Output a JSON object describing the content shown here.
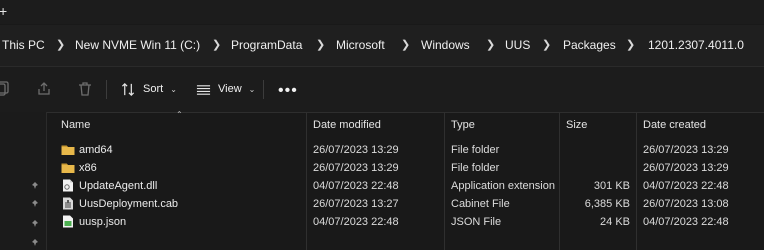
{
  "window": {
    "new_tab_glyph": "+"
  },
  "breadcrumb": [
    "This PC",
    "New NVME Win 11 (C:)",
    "ProgramData",
    "Microsoft",
    "Windows",
    "UUS",
    "Packages",
    "1201.2307.4011.0"
  ],
  "toolbar": {
    "sort_label": "Sort",
    "view_label": "View",
    "more_label": "•••",
    "icons": [
      "copy-icon",
      "share-icon",
      "delete-icon",
      "sort-icon",
      "view-icon",
      "more-icon"
    ]
  },
  "columns": {
    "name": "Name",
    "date_modified": "Date modified",
    "type": "Type",
    "size": "Size",
    "date_created": "Date created"
  },
  "files": [
    {
      "icon": "folder-icon",
      "name": "amd64",
      "date_modified": "26/07/2023 13:29",
      "type": "File folder",
      "size": "",
      "date_created": "26/07/2023 13:29"
    },
    {
      "icon": "folder-icon",
      "name": "x86",
      "date_modified": "26/07/2023 13:29",
      "type": "File folder",
      "size": "",
      "date_created": "26/07/2023 13:29"
    },
    {
      "icon": "dll-file-icon",
      "name": "UpdateAgent.dll",
      "date_modified": "04/07/2023 22:48",
      "type": "Application extension",
      "size": "301 KB",
      "date_created": "04/07/2023 22:48"
    },
    {
      "icon": "cab-file-icon",
      "name": "UusDeployment.cab",
      "date_modified": "26/07/2023 13:27",
      "type": "Cabinet File",
      "size": "6,385 KB",
      "date_created": "26/07/2023 13:08"
    },
    {
      "icon": "json-file-icon",
      "name": "uusp.json",
      "date_modified": "04/07/2023 22:48",
      "type": "JSON File",
      "size": "24 KB",
      "date_created": "04/07/2023 22:48"
    }
  ],
  "colors": {
    "background": "#191919",
    "folder": "#e8b84a",
    "text": "#ececec"
  }
}
